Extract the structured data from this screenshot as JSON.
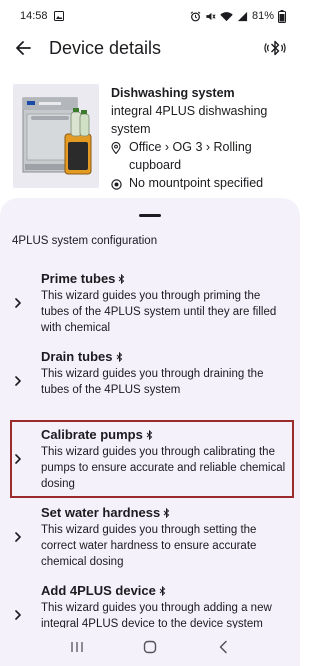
{
  "status_bar": {
    "time": "14:58",
    "battery": "81%",
    "icons": [
      "gallery-icon",
      "alarm-icon",
      "mute-icon",
      "wifi-icon",
      "signal-icon",
      "battery-icon"
    ]
  },
  "app_bar": {
    "title": "Device details",
    "back_icon": "arrow-back-icon",
    "action_icon": "bluetooth-connected-icon"
  },
  "device": {
    "name": "Dishwashing system",
    "model": "integral 4PLUS dishwashing system",
    "location": "Office › OG 3 › Rolling cupboard",
    "mountpoint": "No mountpoint specified",
    "location_icon": "location-pin-icon",
    "mountpoint_icon": "target-icon"
  },
  "sheet": {
    "section_title": "4PLUS system configuration",
    "items": [
      {
        "title": "Prime tubes",
        "description": "This wizard guides you through priming the tubes of the 4PLUS system until they are filled with chemical",
        "highlighted": false
      },
      {
        "title": "Drain tubes",
        "description": "This wizard guides you through draining the tubes of the 4PLUS system",
        "highlighted": false
      },
      {
        "title": "Calibrate pumps",
        "description": "This wizard guides you through calibrating the pumps to ensure accurate and reliable chemical dosing",
        "highlighted": true
      },
      {
        "title": "Set water hardness",
        "description": "This wizard guides you through setting the correct water hardness to ensure accurate chemical dosing",
        "highlighted": false
      },
      {
        "title": "Add 4PLUS device",
        "description": "This wizard guides you through adding a new integral 4PLUS device to the device system",
        "highlighted": false
      }
    ]
  },
  "nav_bar": {
    "icons": [
      "recent-apps-icon",
      "home-icon",
      "back-icon"
    ]
  },
  "colors": {
    "sheet_background": "#f4f1fa",
    "highlight_border": "#9b2a2a",
    "text": "#1c1b1f"
  }
}
